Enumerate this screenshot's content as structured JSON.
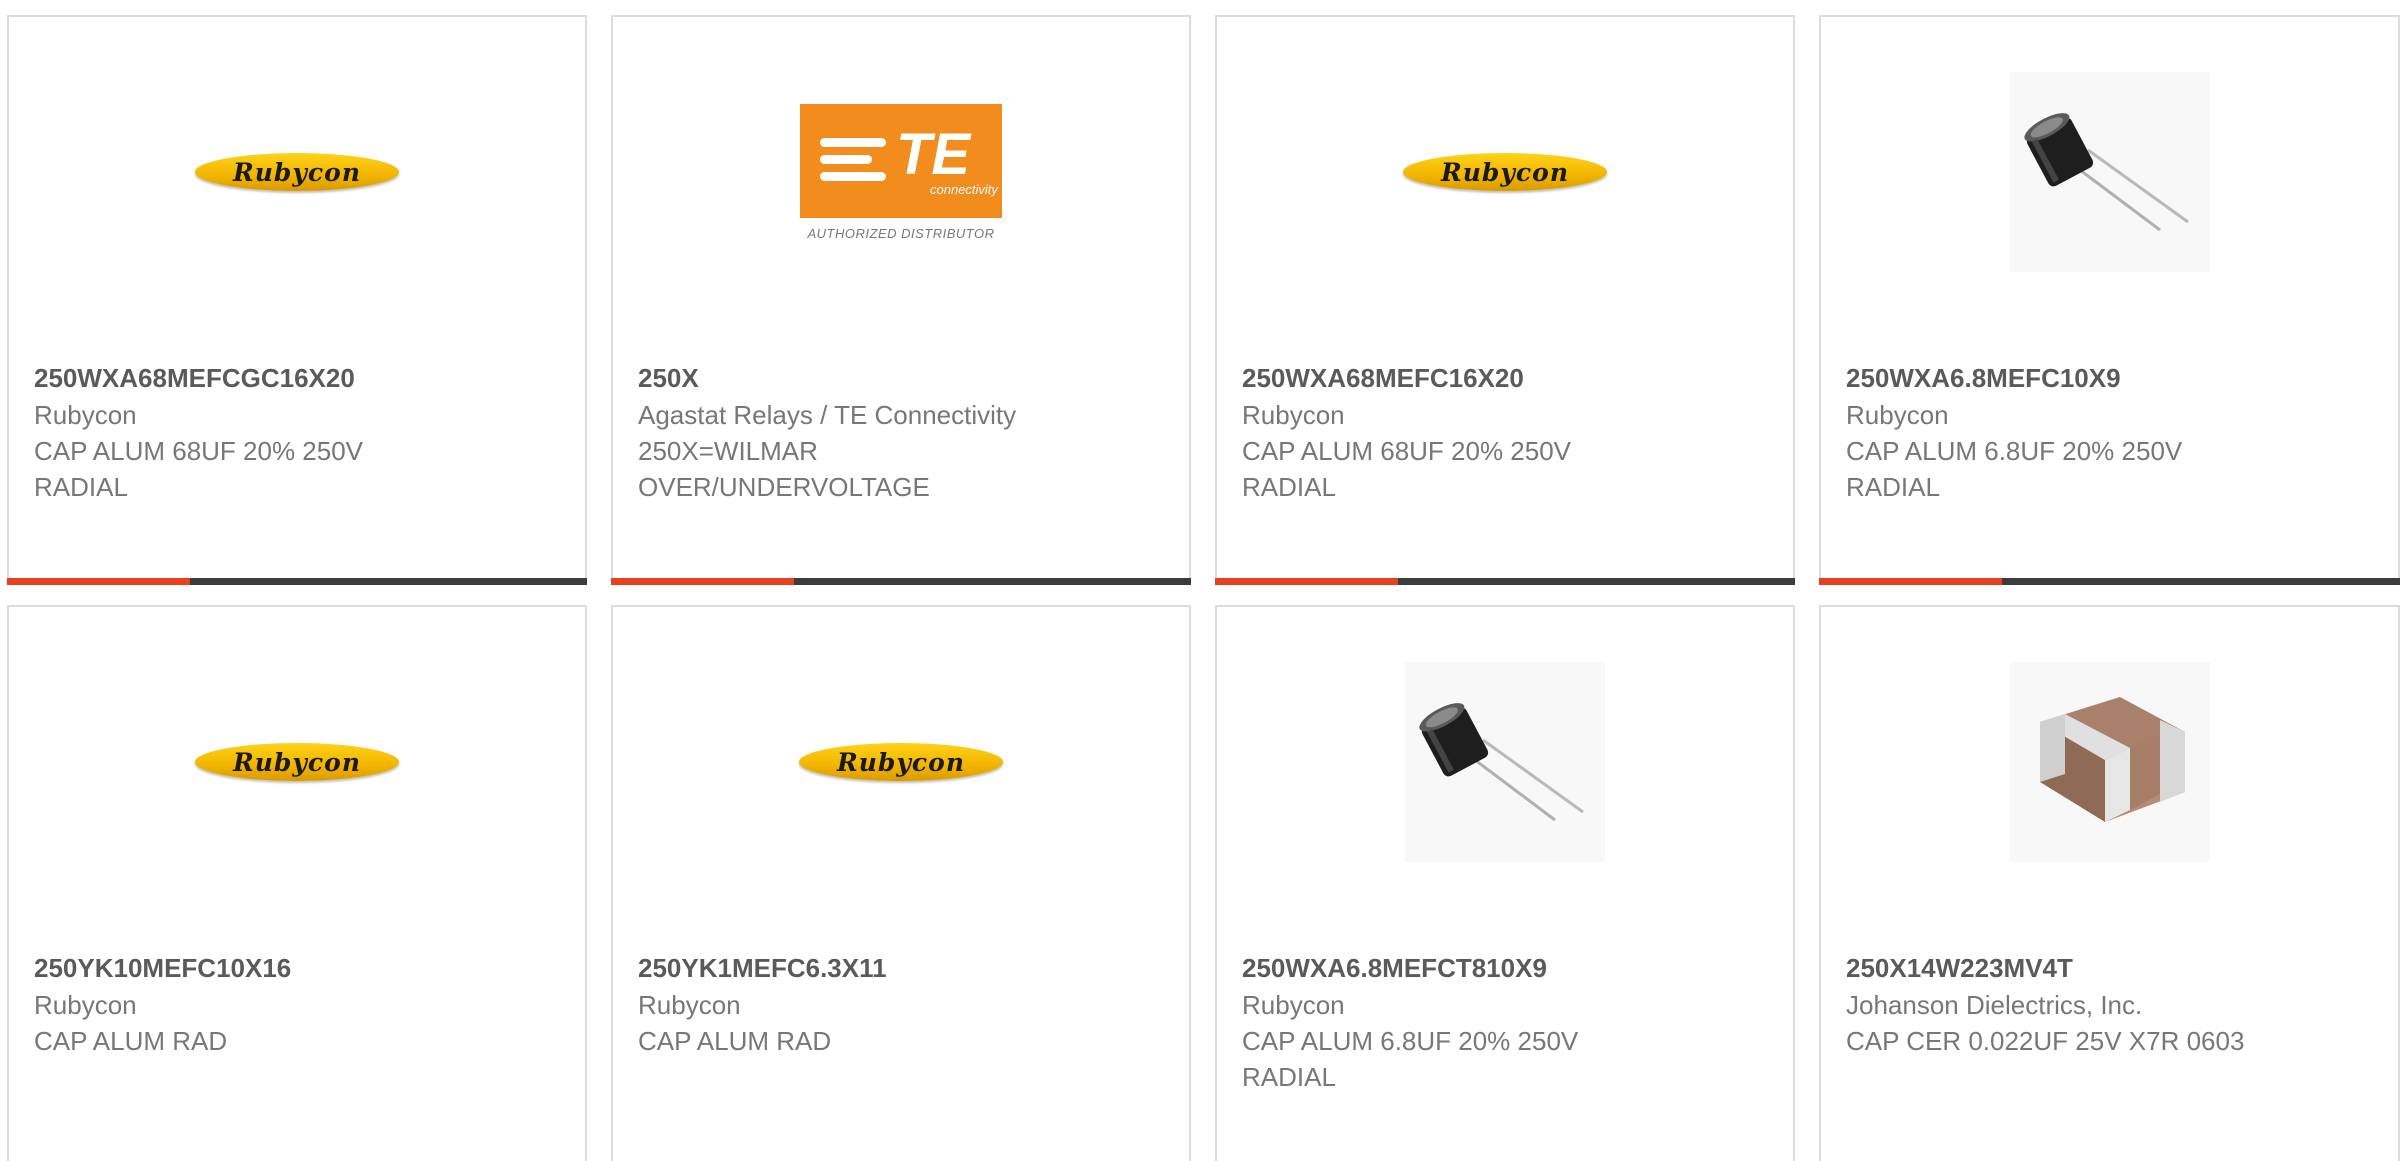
{
  "products": [
    {
      "part_number": "250WXA68MEFCGC16X20",
      "manufacturer": "Rubycon",
      "description": "CAP ALUM 68UF 20% 250V RADIAL",
      "image": "rubycon-logo",
      "logo_text": "Rubycon"
    },
    {
      "part_number": "250X",
      "manufacturer": "Agastat Relays / TE Connectivity",
      "description": "250X=WILMAR OVER/UNDERVOLTAGE",
      "image": "te-connectivity-logo",
      "logo_text": "TE",
      "logo_subtext": "connectivity",
      "logo_caption": "AUTHORIZED DISTRIBUTOR"
    },
    {
      "part_number": "250WXA68MEFC16X20",
      "manufacturer": "Rubycon",
      "description": "CAP ALUM 68UF 20% 250V RADIAL",
      "image": "rubycon-logo",
      "logo_text": "Rubycon"
    },
    {
      "part_number": "250WXA6.8MEFC10X9",
      "manufacturer": "Rubycon",
      "description": "CAP ALUM 6.8UF 20% 250V RADIAL",
      "image": "radial-capacitor-photo"
    },
    {
      "part_number": "250YK10MEFC10X16",
      "manufacturer": "Rubycon",
      "description": "CAP ALUM RAD",
      "image": "rubycon-logo",
      "logo_text": "Rubycon"
    },
    {
      "part_number": "250YK1MEFC6.3X11",
      "manufacturer": "Rubycon",
      "description": "CAP ALUM RAD",
      "image": "rubycon-logo",
      "logo_text": "Rubycon"
    },
    {
      "part_number": "250WXA6.8MEFCT810X9",
      "manufacturer": "Rubycon",
      "description": "CAP ALUM 6.8UF 20% 250V RADIAL",
      "image": "radial-capacitor-photo"
    },
    {
      "part_number": "250X14W223MV4T",
      "manufacturer": "Johanson Dielectrics, Inc.",
      "description": "CAP CER 0.022UF 25V X7R 0603",
      "image": "ceramic-chip-capacitor-photo"
    }
  ],
  "colors": {
    "accent_bar": "#e8401c",
    "bar_dark": "#3c3c3c",
    "rubycon_yellow": "#f2b400",
    "te_orange": "#f28c1d"
  }
}
